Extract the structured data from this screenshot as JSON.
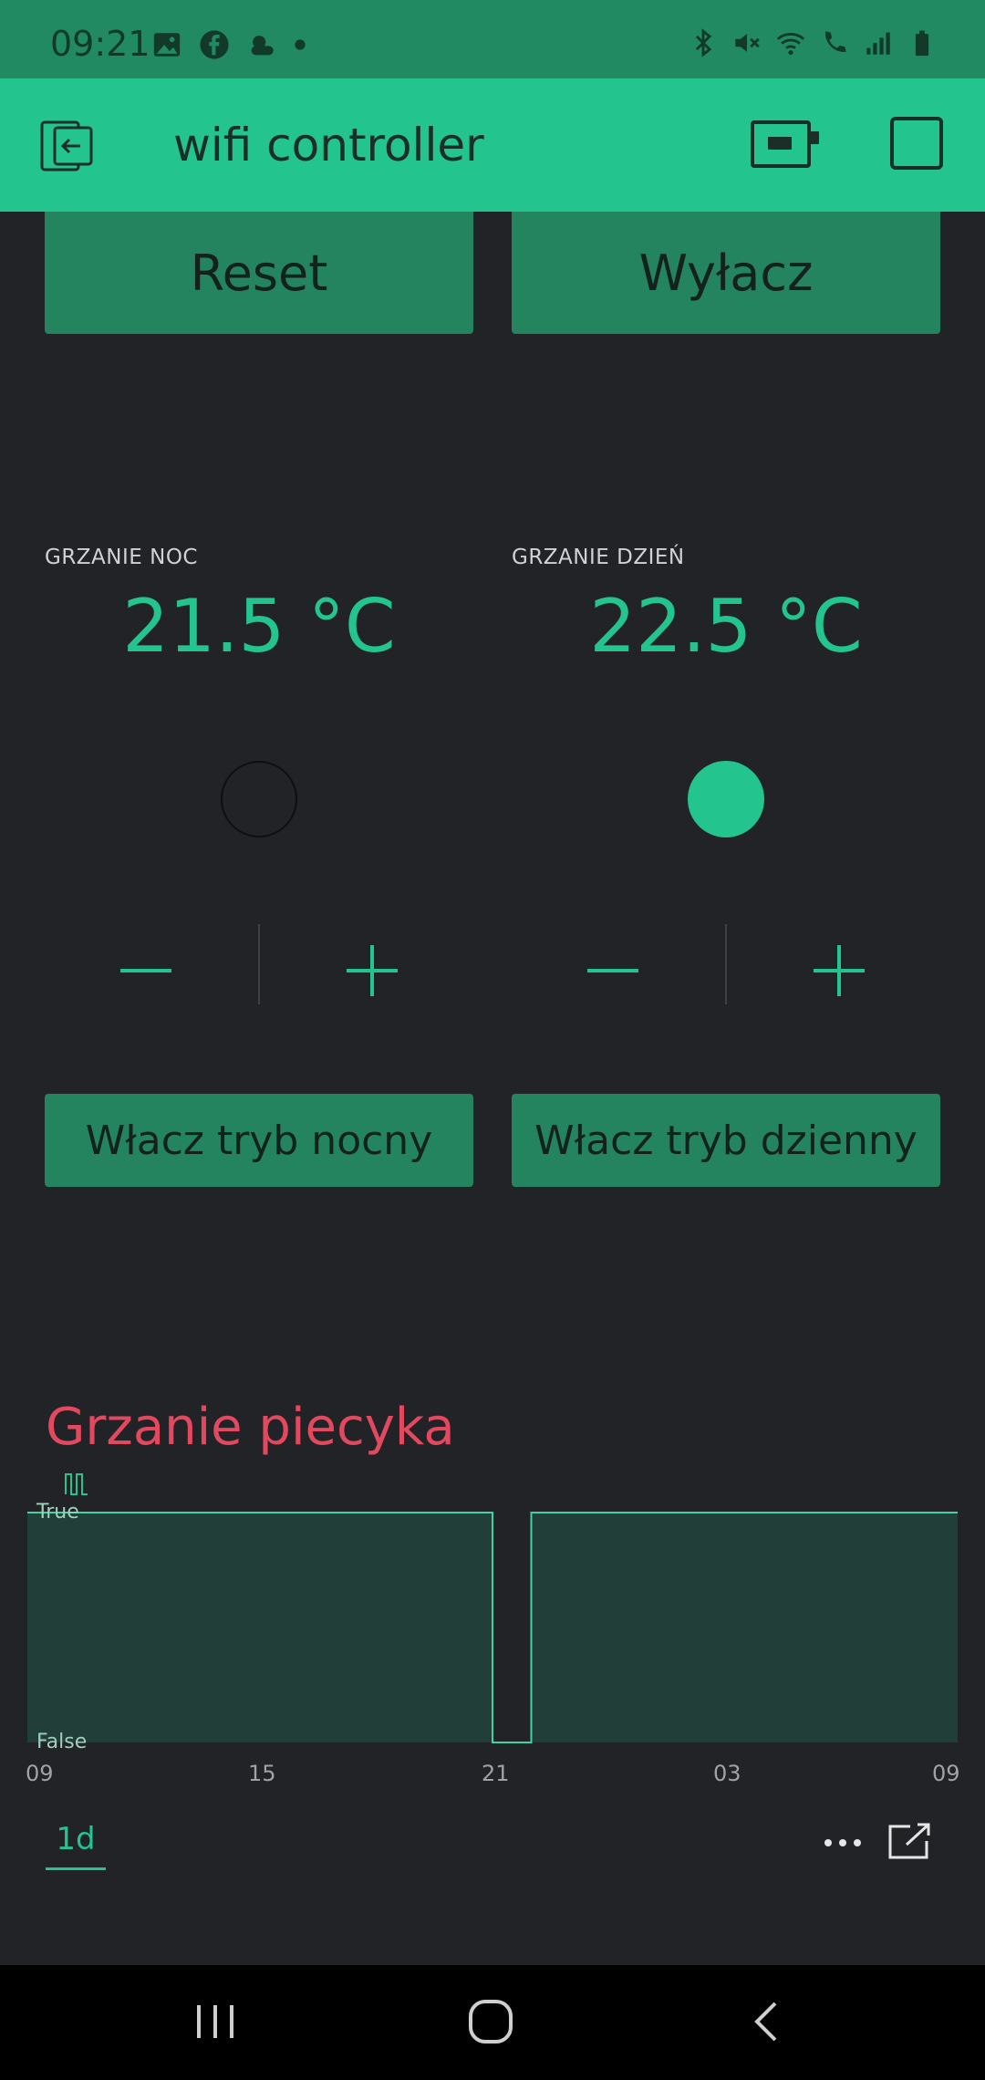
{
  "status_bar": {
    "time": "09:21",
    "left_icons": [
      "image-icon",
      "facebook-icon",
      "weather-icon",
      "dot-icon"
    ],
    "right_icons": [
      "bluetooth-icon",
      "mute-icon",
      "wifi-icon",
      "call-icon",
      "signal-icon",
      "battery-icon"
    ]
  },
  "app_bar": {
    "title": "wifi controller"
  },
  "buttons": {
    "reset": "Reset",
    "off": "Wyłacz",
    "night_mode": "Włacz tryb nocny",
    "day_mode": "Włacz tryb dzienny"
  },
  "heating_night": {
    "label": "GRZANIE NOC",
    "value": "21.5 °C",
    "led_on": false
  },
  "heating_day": {
    "label": "GRZANIE DZIEŃ",
    "value": "22.5 °C",
    "led_on": true
  },
  "colors": {
    "accent": "#23c48e",
    "button": "#23845f",
    "background": "#222327",
    "chart_title": "#e2495f"
  },
  "chart_data": {
    "type": "area",
    "title": "Grzanie piecyka",
    "y_labels": [
      "True",
      "False"
    ],
    "x_ticks": [
      "09",
      "15",
      "21",
      "03",
      "09"
    ],
    "x_hours": [
      9,
      21,
      21,
      22,
      22,
      33
    ],
    "values": [
      1,
      1,
      0,
      0,
      1,
      1
    ],
    "xlim": [
      9,
      33
    ],
    "ylim": [
      0,
      1
    ],
    "range": "1d"
  }
}
